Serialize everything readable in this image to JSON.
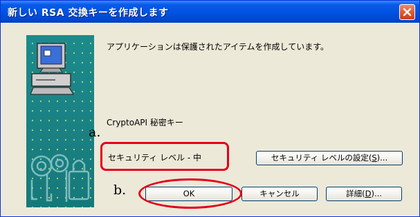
{
  "window": {
    "title": "新しい RSA 交換キーを作成します"
  },
  "message": "アプリケーションは保護されたアイテムを作成しています。",
  "key_label": "CryptoAPI 秘密キー",
  "security_level": "セキュリティ レベル - 中",
  "buttons": {
    "set_level": {
      "text": "セキュリティ レベルの設定(",
      "mnemonic": "S",
      "suffix": ")..."
    },
    "ok": "OK",
    "cancel": "キャンセル",
    "details": {
      "text": "詳細(",
      "mnemonic": "D",
      "suffix": ")..."
    }
  },
  "annotations": {
    "a": "a.",
    "b": "b."
  },
  "colors": {
    "title_bar": "#0054e3",
    "dialog_bg": "#ece9d8",
    "annotation_red": "#e3001b",
    "art_teal": "#1a8082"
  }
}
